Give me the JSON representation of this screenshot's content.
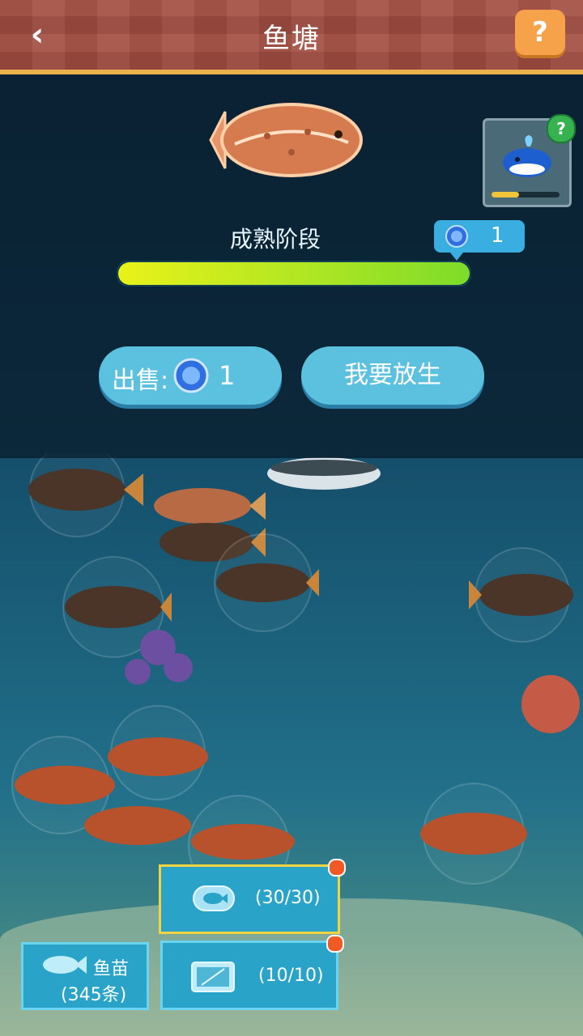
{
  "header": {
    "title": "鱼塘",
    "back_icon": "back-arrow-icon",
    "help_label": "?"
  },
  "featured": {
    "fish_name_icon": "flounder-fish-icon",
    "stage_label": "成熟阶段",
    "progress_fraction": 1.0,
    "reward_value": "1"
  },
  "whale_card": {
    "icon": "whale-icon",
    "help_label": "?",
    "progress_fraction": 0.4
  },
  "actions": {
    "sell_prefix": "出售:",
    "sell_value": "1",
    "release_label": "我要放生"
  },
  "tiles": {
    "capacity_text": "(30/30)",
    "seedlings_label": "鱼苗",
    "seedlings_count": "(345条)",
    "tank_text": "(10/10)"
  },
  "colors": {
    "accent": "#5cc0df",
    "header": "#a7564a",
    "progress": "#b8e826",
    "notification": "#f15a24"
  }
}
